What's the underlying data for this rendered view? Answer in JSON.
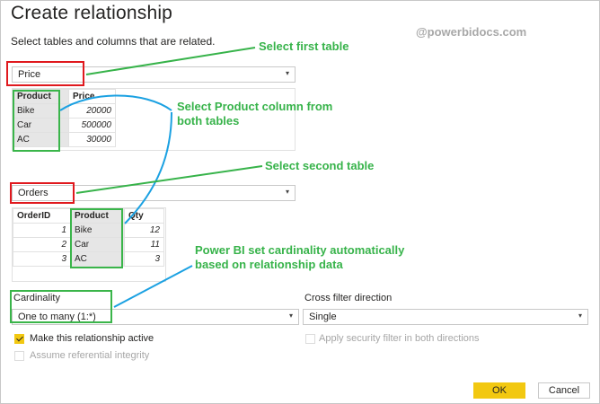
{
  "dialog": {
    "title": "Create relationship",
    "subtitle": "Select tables and columns that are related.",
    "watermark": "@powerbidocs.com"
  },
  "table1": {
    "selected": "Price",
    "columns": [
      "Product",
      "Price"
    ],
    "rows": [
      [
        "Bike",
        "20000"
      ],
      [
        "Car",
        "500000"
      ],
      [
        "AC",
        "30000"
      ]
    ]
  },
  "table2": {
    "selected": "Orders",
    "columns": [
      "OrderID",
      "Product",
      "Qty"
    ],
    "rows": [
      [
        "1",
        "Bike",
        "12"
      ],
      [
        "2",
        "Car",
        "11"
      ],
      [
        "3",
        "AC",
        "3"
      ]
    ]
  },
  "cardinality": {
    "label": "Cardinality",
    "value": "One to many (1:*)"
  },
  "cross_filter": {
    "label": "Cross filter direction",
    "value": "Single"
  },
  "options": {
    "active_label": "Make this relationship active",
    "security_label": "Apply security filter in both directions",
    "integrity_label": "Assume referential integrity"
  },
  "buttons": {
    "ok": "OK",
    "cancel": "Cancel"
  },
  "annotations": {
    "first_table": "Select first table",
    "product_col_line1": "Select Product column from",
    "product_col_line2": "both tables",
    "second_table": "Select second table",
    "cardinality_line1": "Power BI set cardinality automatically",
    "cardinality_line2": "based on relationship data"
  },
  "colors": {
    "accent": "#f2c811",
    "annotation_green": "#37b34a",
    "highlight_red": "#e0191e",
    "arrow_blue": "#1ba1e2"
  }
}
